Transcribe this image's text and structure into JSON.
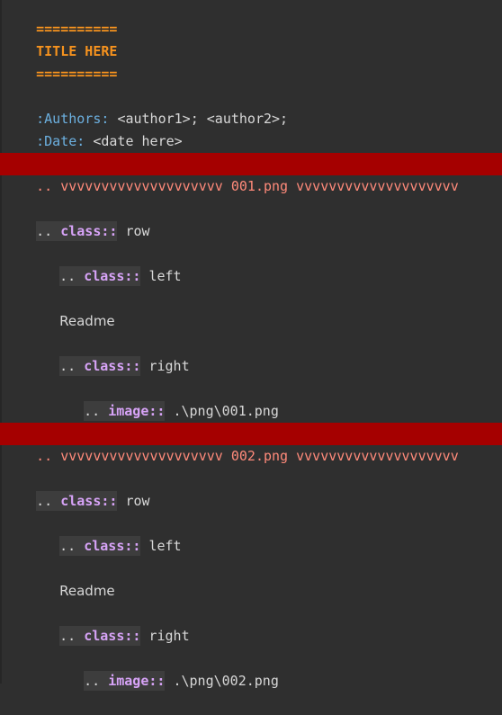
{
  "editor": {
    "title_rule_top": "==========",
    "title": "TITLE HERE",
    "title_rule_bottom": "==========",
    "authors_field": ":Authors:",
    "authors_value": "<author1>; <author2>;",
    "date_field": ":Date:",
    "date_value": "<date here>",
    "blocks": [
      {
        "separator": ".. vvvvvvvvvvvvvvvvvvvv 001.png vvvvvvvvvvvvvvvvvvvv",
        "row_dots": "..",
        "row_kw": "class::",
        "row_val": "row",
        "left_dots": "..",
        "left_kw": "class::",
        "left_val": "left",
        "readme": "Readme",
        "right_dots": "..",
        "right_kw": "class::",
        "right_val": "right",
        "image_dots": "..",
        "image_kw": "image::",
        "image_val": ".\\png\\001.png"
      },
      {
        "separator": ".. vvvvvvvvvvvvvvvvvvvv 002.png vvvvvvvvvvvvvvvvvvvv",
        "row_dots": "..",
        "row_kw": "class::",
        "row_val": "row",
        "left_dots": "..",
        "left_kw": "class::",
        "left_val": "left",
        "readme": "Readme",
        "right_dots": "..",
        "right_kw": "class::",
        "right_val": "right",
        "image_dots": "..",
        "image_kw": "image::",
        "image_val": ".\\png\\002.png"
      }
    ]
  },
  "colors": {
    "background": "#2f2f2f",
    "heading": "#f7931e",
    "field_name": "#6cb0e0",
    "directive_keyword": "#d7a3f7",
    "separator_bar": "#a50000",
    "separator_text": "#ff8a7a"
  }
}
